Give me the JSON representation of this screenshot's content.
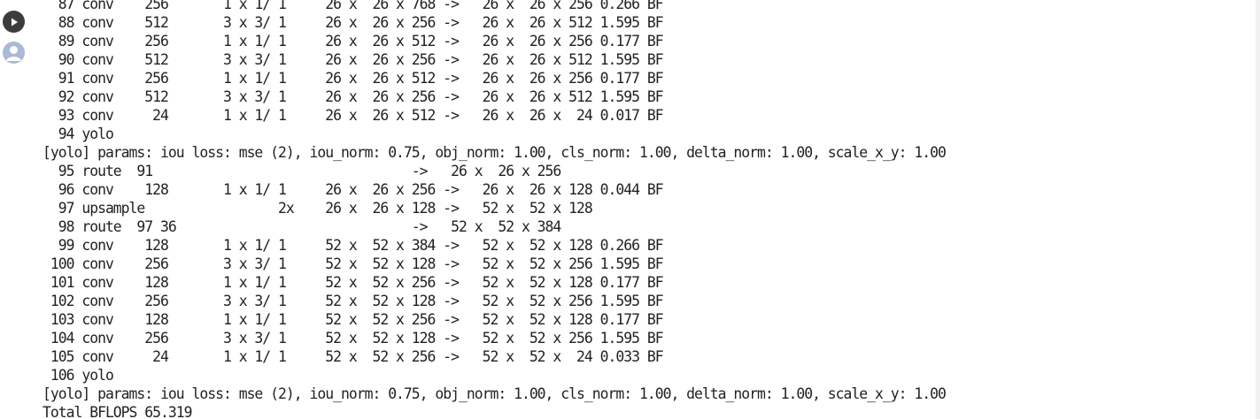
{
  "colors": {
    "background": "#ffffff",
    "text": "#212121",
    "run_button": "#3c3c3c",
    "avatar": "#aab9d6"
  },
  "gutter": {
    "run_icon": "play-icon",
    "avatar_icon": "user-avatar-icon"
  },
  "output_lines": [
    "  87 conv    256       1 x 1/ 1     26 x  26 x 768 ->   26 x  26 x 256 0.266 BF",
    "  88 conv    512       3 x 3/ 1     26 x  26 x 256 ->   26 x  26 x 512 1.595 BF",
    "  89 conv    256       1 x 1/ 1     26 x  26 x 512 ->   26 x  26 x 256 0.177 BF",
    "  90 conv    512       3 x 3/ 1     26 x  26 x 256 ->   26 x  26 x 512 1.595 BF",
    "  91 conv    256       1 x 1/ 1     26 x  26 x 512 ->   26 x  26 x 256 0.177 BF",
    "  92 conv    512       3 x 3/ 1     26 x  26 x 256 ->   26 x  26 x 512 1.595 BF",
    "  93 conv     24       1 x 1/ 1     26 x  26 x 512 ->   26 x  26 x  24 0.017 BF",
    "  94 yolo",
    "[yolo] params: iou loss: mse (2), iou_norm: 0.75, obj_norm: 1.00, cls_norm: 1.00, delta_norm: 1.00, scale_x_y: 1.00",
    "  95 route  91                                 ->   26 x  26 x 256",
    "  96 conv    128       1 x 1/ 1     26 x  26 x 256 ->   26 x  26 x 128 0.044 BF",
    "  97 upsample                 2x    26 x  26 x 128 ->   52 x  52 x 128",
    "  98 route  97 36                              ->   52 x  52 x 384",
    "  99 conv    128       1 x 1/ 1     52 x  52 x 384 ->   52 x  52 x 128 0.266 BF",
    " 100 conv    256       3 x 3/ 1     52 x  52 x 128 ->   52 x  52 x 256 1.595 BF",
    " 101 conv    128       1 x 1/ 1     52 x  52 x 256 ->   52 x  52 x 128 0.177 BF",
    " 102 conv    256       3 x 3/ 1     52 x  52 x 128 ->   52 x  52 x 256 1.595 BF",
    " 103 conv    128       1 x 1/ 1     52 x  52 x 256 ->   52 x  52 x 128 0.177 BF",
    " 104 conv    256       3 x 3/ 1     52 x  52 x 128 ->   52 x  52 x 256 1.595 BF",
    " 105 conv     24       1 x 1/ 1     52 x  52 x 256 ->   52 x  52 x  24 0.033 BF",
    " 106 yolo",
    "[yolo] params: iou loss: mse (2), iou_norm: 0.75, obj_norm: 1.00, cls_norm: 1.00, delta_norm: 1.00, scale_x_y: 1.00",
    "Total BFLOPS 65.319"
  ]
}
